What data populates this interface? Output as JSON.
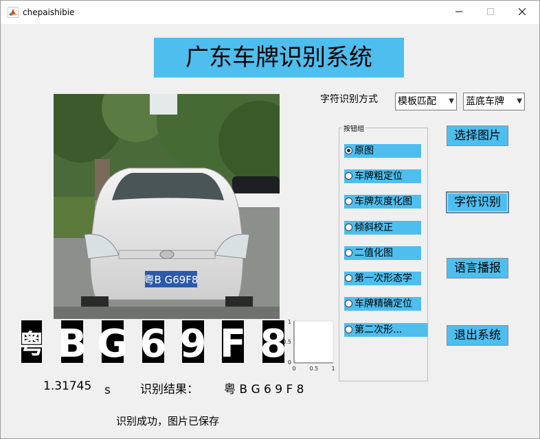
{
  "window": {
    "title": "chepaishibie"
  },
  "banner": {
    "title": "广东车牌识别系统"
  },
  "controls": {
    "recognition_method_label": "字符识别方式",
    "method_select": "模板匹配",
    "plate_color_select": "蓝底车牌"
  },
  "group": {
    "title": "按钮组",
    "options": [
      "原图",
      "车牌粗定位",
      "车牌灰度化图",
      "倾斜校正",
      "二值化图",
      "第一次形态学",
      "车牌精确定位",
      "第二次形..."
    ],
    "selected_index": 0
  },
  "buttons": {
    "select_image": "选择图片",
    "recognize": "字符识别",
    "voice": "语言播报",
    "exit": "退出系统"
  },
  "plate_photo_text": "粤B G69F8",
  "segmented_chars": [
    "粤",
    "B",
    "G",
    "6",
    "9",
    "F",
    "8"
  ],
  "small_axes": {
    "y_ticks": [
      "1",
      "0.5",
      "0"
    ],
    "x_ticks": [
      "0",
      "0.5",
      "1"
    ]
  },
  "result": {
    "time_value": "1.31745",
    "time_unit": "s",
    "label": "识别结果：",
    "value": "粤 B G 6 9 F 8",
    "status": "识别成功，图片已保存"
  },
  "colors": {
    "accent": "#4dbeee",
    "background": "#f0f0f0"
  }
}
